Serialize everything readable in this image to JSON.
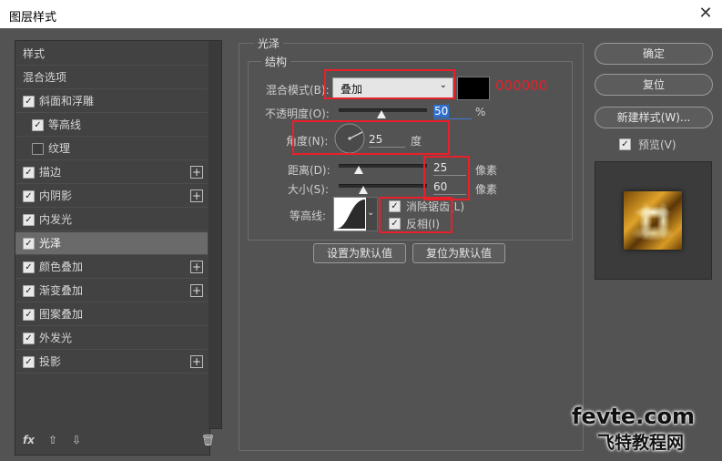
{
  "window": {
    "title": "图层样式",
    "close_glyph": "✕"
  },
  "styles_list": {
    "items": [
      {
        "label": "样式",
        "checkbox": null,
        "plus": false,
        "indent": 0,
        "selected": false
      },
      {
        "label": "混合选项",
        "checkbox": null,
        "plus": false,
        "indent": 0,
        "selected": false
      },
      {
        "label": "斜面和浮雕",
        "checkbox": true,
        "plus": false,
        "indent": 0,
        "selected": false
      },
      {
        "label": "等高线",
        "checkbox": true,
        "plus": false,
        "indent": 1,
        "selected": false
      },
      {
        "label": "纹理",
        "checkbox": false,
        "plus": false,
        "indent": 1,
        "selected": false
      },
      {
        "label": "描边",
        "checkbox": true,
        "plus": true,
        "indent": 0,
        "selected": false
      },
      {
        "label": "内阴影",
        "checkbox": true,
        "plus": true,
        "indent": 0,
        "selected": false
      },
      {
        "label": "内发光",
        "checkbox": true,
        "plus": false,
        "indent": 0,
        "selected": false
      },
      {
        "label": "光泽",
        "checkbox": true,
        "plus": false,
        "indent": 0,
        "selected": true
      },
      {
        "label": "颜色叠加",
        "checkbox": true,
        "plus": true,
        "indent": 0,
        "selected": false
      },
      {
        "label": "渐变叠加",
        "checkbox": true,
        "plus": true,
        "indent": 0,
        "selected": false
      },
      {
        "label": "图案叠加",
        "checkbox": true,
        "plus": false,
        "indent": 0,
        "selected": false
      },
      {
        "label": "外发光",
        "checkbox": true,
        "plus": false,
        "indent": 0,
        "selected": false
      },
      {
        "label": "投影",
        "checkbox": true,
        "plus": true,
        "indent": 0,
        "selected": false
      }
    ],
    "tools": {
      "fx": "fx",
      "up": "⇧",
      "down": "⇩",
      "trash": "🗑"
    }
  },
  "satin": {
    "group_title": "光泽",
    "structure_title": "结构",
    "blend_mode_label": "混合模式(B):",
    "blend_mode_value": "叠加",
    "color_hex": "000000",
    "color_value": "#000000",
    "opacity_label": "不透明度(O):",
    "opacity_value": "50",
    "opacity_unit": "%",
    "angle_label": "角度(N):",
    "angle_value": "25",
    "angle_unit": "度",
    "distance_label": "距离(D):",
    "distance_value": "25",
    "distance_unit": "像素",
    "size_label": "大小(S):",
    "size_value": "60",
    "size_unit": "像素",
    "contour_label": "等高线:",
    "antialias_label": "消除锯齿(L)",
    "antialias_checked": true,
    "invert_label": "反相(I)",
    "invert_checked": true,
    "make_default_label": "设置为默认值",
    "reset_default_label": "复位为默认值"
  },
  "right_panel": {
    "ok_label": "确定",
    "reset_label": "复位",
    "new_style_label": "新建样式(W)...",
    "preview_label": "预览(V)",
    "preview_checked": true
  },
  "watermark": {
    "line1": "fevte.com",
    "line2": "飞特教程网"
  },
  "colors": {
    "annotation_red": "#e8202a",
    "selected_row": "#6a6a6a",
    "panel_bg": "#535353"
  }
}
